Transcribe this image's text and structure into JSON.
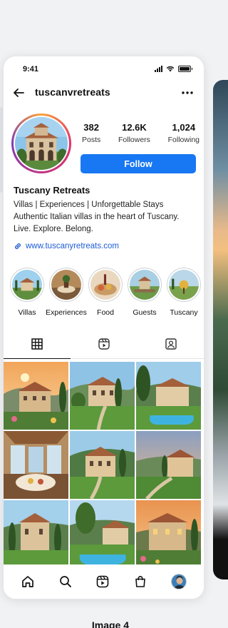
{
  "status": {
    "time": "9:41"
  },
  "header": {
    "username": "tuscanvretreats"
  },
  "stats": [
    {
      "value": "382",
      "label": "Posts"
    },
    {
      "value": "12.6K",
      "label": "Followers"
    },
    {
      "value": "1,024",
      "label": "Following"
    }
  ],
  "follow_label": "Follow",
  "bio": {
    "name": "Tuscany Retreats",
    "line1": "Villas | Experiences | Unforgettable Stays",
    "line2": "Authentic Italian villas in the heart of Tuscany.",
    "line3": "Live. Explore. Belong.",
    "link": "www.tuscanyretreats.com"
  },
  "highlights": [
    {
      "label": "Villas"
    },
    {
      "label": "Experiences"
    },
    {
      "label": "Food"
    },
    {
      "label": "Guests"
    },
    {
      "label": "Tuscany"
    }
  ],
  "tabs": [
    "grid-icon",
    "reels-icon",
    "tagged-icon"
  ],
  "colors": {
    "accent": "#1877f2",
    "link": "#1c5bd6"
  },
  "bottom_nav": [
    "home-icon",
    "search-icon",
    "reels-icon",
    "shop-icon",
    "profile-avatar"
  ],
  "caption": "Image 4"
}
